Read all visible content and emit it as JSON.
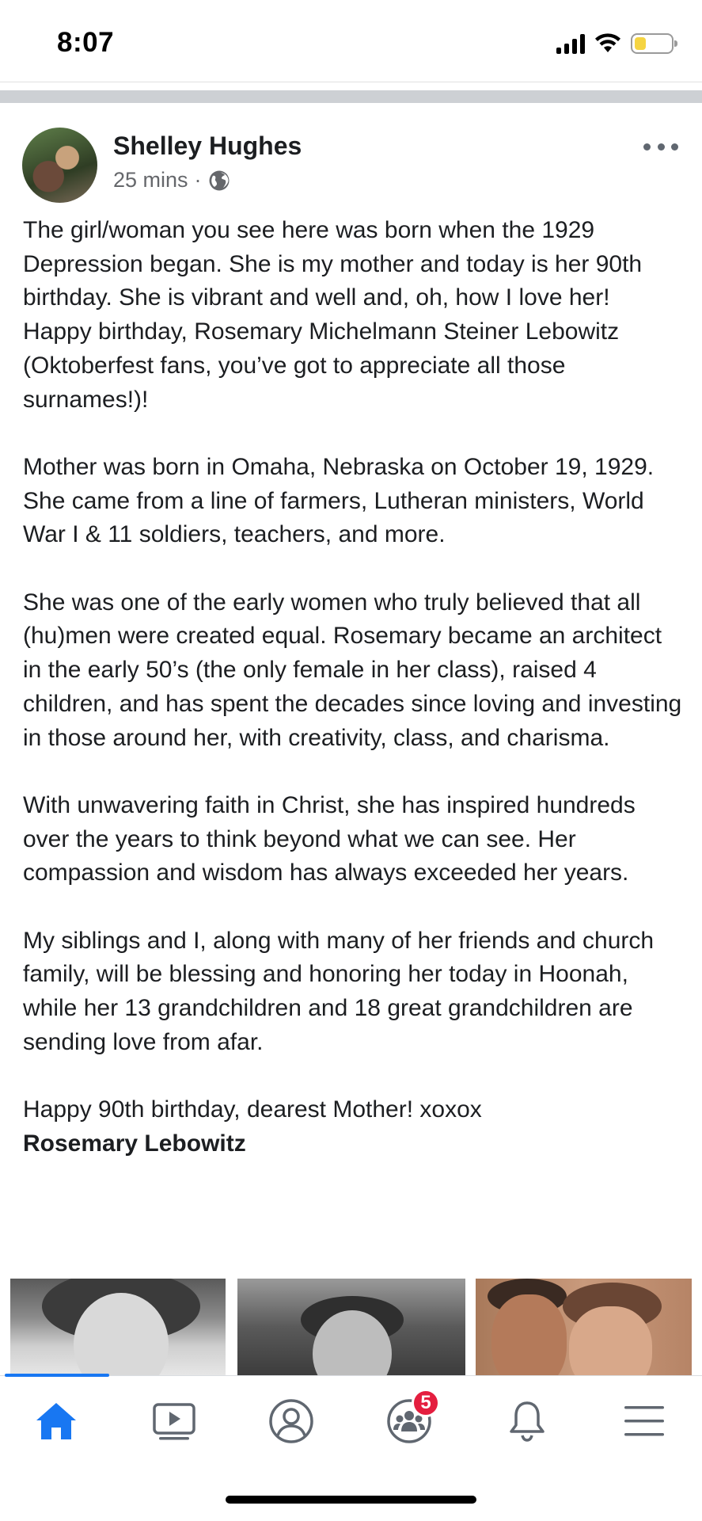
{
  "status_bar": {
    "time": "8:07"
  },
  "post": {
    "author": "Shelley Hughes",
    "time_ago": "25 mins",
    "separator": "·",
    "paragraphs": [
      "The girl/woman you see here was born when the 1929 Depression began. She is my mother and today is her 90th birthday. She is vibrant and well and, oh, how I love her!  Happy birthday, Rosemary Michelmann Steiner Lebowitz (Oktoberfest fans, you’ve got to appreciate all those surnames!)!",
      "Mother was born in Omaha, Nebraska on October 19, 1929. She came from a line of farmers, Lutheran ministers, World War I & 11 soldiers, teachers, and more.",
      "She was one of the early women who truly  believed that all (hu)men were created equal. Rosemary became an architect in the early 50’s (the only female in her class), raised 4 children, and has spent the decades since loving and investing in those around her, with creativity, class, and charisma.",
      "With unwavering faith in Christ, she has inspired hundreds over the years to think beyond what we can see. Her compassion and wisdom has always exceeded her years.",
      "My siblings and I, along with many of her friends and church family, will be blessing and honoring her today in Hoonah, while her 13 grandchildren and 18 great grandchildren are sending love from afar."
    ],
    "closing": "Happy 90th birthday, dearest Mother! xoxox",
    "tagged_person": "Rosemary Lebowitz",
    "photos": [
      "photo-1",
      "photo-2",
      "photo-3"
    ]
  },
  "tab_bar": {
    "tabs": [
      {
        "name": "home",
        "icon": "home-icon",
        "active": true
      },
      {
        "name": "watch",
        "icon": "video-icon",
        "active": false
      },
      {
        "name": "profile",
        "icon": "profile-icon",
        "active": false
      },
      {
        "name": "groups",
        "icon": "groups-icon",
        "active": false,
        "badge": "5"
      },
      {
        "name": "notifications",
        "icon": "bell-icon",
        "active": false
      },
      {
        "name": "menu",
        "icon": "menu-icon",
        "active": false
      }
    ]
  },
  "colors": {
    "accent": "#1877f2",
    "badge": "#e41e3f",
    "text": "#1c1e21",
    "secondary_text": "#65676b",
    "icon_gray": "#606770"
  }
}
